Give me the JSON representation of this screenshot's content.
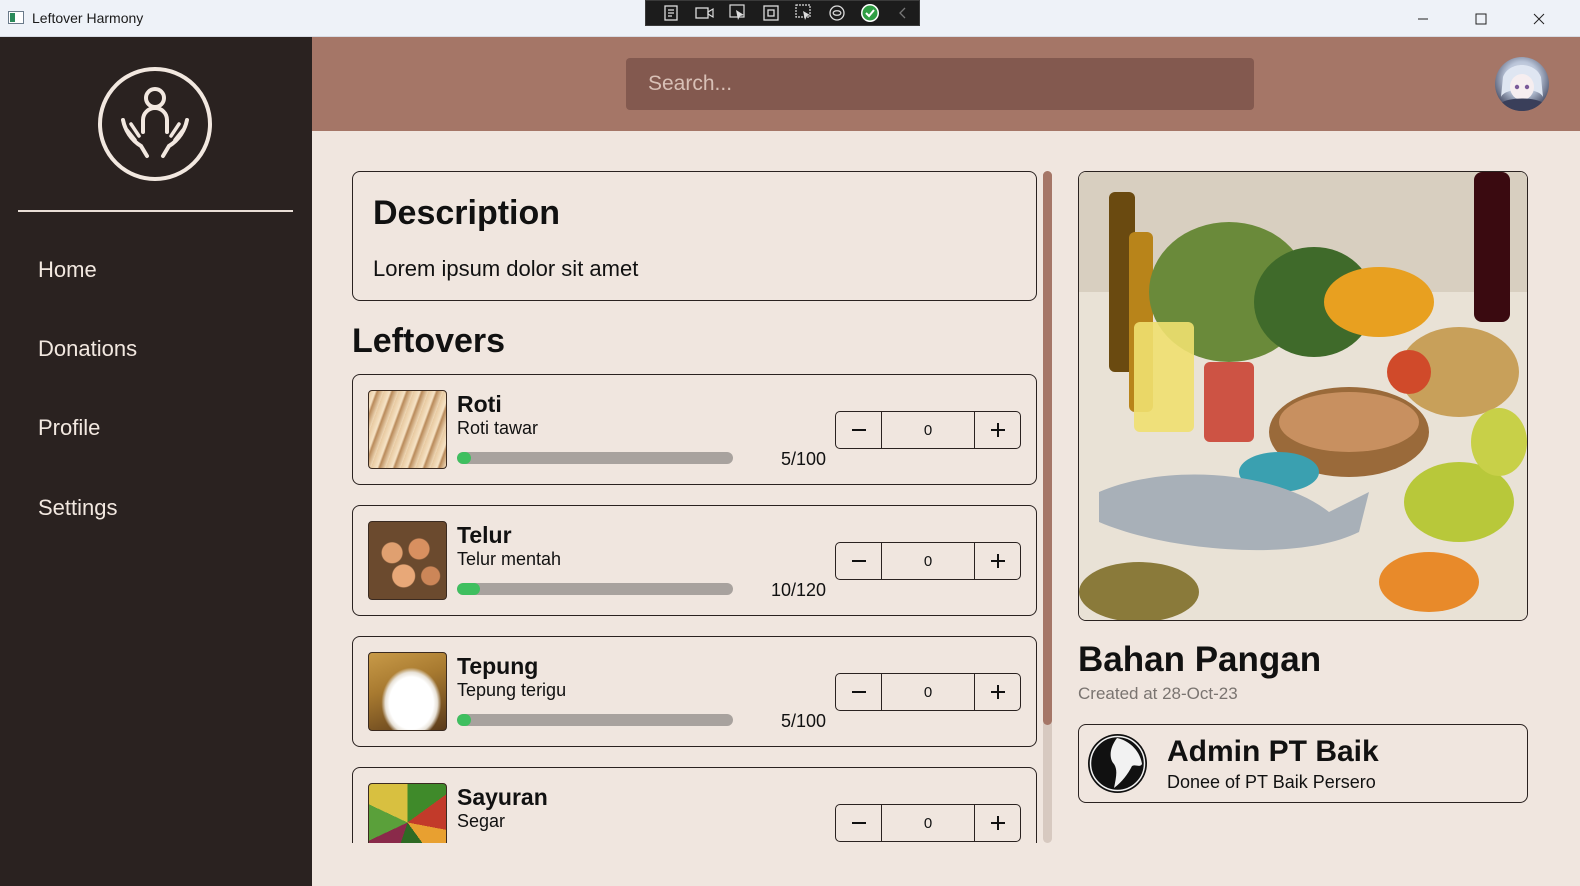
{
  "window": {
    "title": "Leftover Harmony"
  },
  "sidebar": {
    "items": [
      {
        "label": "Home",
        "icon": "home"
      },
      {
        "label": "Donations",
        "icon": "donations"
      },
      {
        "label": "Profile",
        "icon": "profile"
      },
      {
        "label": "Settings",
        "icon": "settings"
      }
    ]
  },
  "header": {
    "search_placeholder": "Search..."
  },
  "description": {
    "title": "Description",
    "text": "Lorem ipsum dolor sit amet"
  },
  "leftovers": {
    "title": "Leftovers",
    "items": [
      {
        "name": "Roti",
        "subtitle": "Roti tawar",
        "count": "5/100",
        "progress": 0.05,
        "quantity": "0"
      },
      {
        "name": "Telur",
        "subtitle": "Telur mentah",
        "count": "10/120",
        "progress": 0.083,
        "quantity": "0"
      },
      {
        "name": "Tepung",
        "subtitle": "Tepung terigu",
        "count": "5/100",
        "progress": 0.05,
        "quantity": "0"
      },
      {
        "name": "Sayuran",
        "subtitle": "Segar",
        "count": "",
        "progress": 0,
        "quantity": "0"
      }
    ]
  },
  "detail": {
    "title": "Bahan Pangan",
    "created": "Created at 28-Oct-23",
    "donee": {
      "name": "Admin PT Baik",
      "subtitle": "Donee of PT Baik Persero"
    }
  },
  "colors": {
    "sidebar": "#2a2220",
    "header": "#a57667",
    "search": "#83594f",
    "background": "#f0e6df",
    "progress_fill": "#3fbf5f",
    "progress_track": "#a8a29e"
  }
}
